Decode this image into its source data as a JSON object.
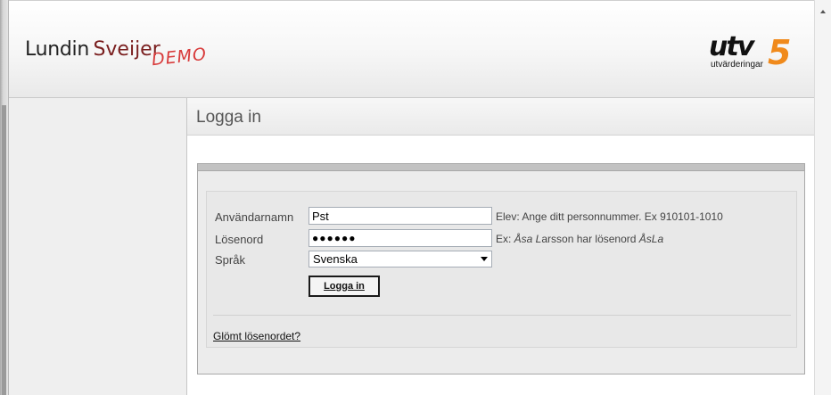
{
  "brand": {
    "name_part1": "Lundin",
    "name_part2": "Sveijer",
    "demo_label": "DEMO",
    "partner_logo_text": "utv",
    "partner_logo_number": "5",
    "partner_logo_sub": "utvärderingar"
  },
  "page": {
    "title": "Logga in"
  },
  "form": {
    "username_label": "Användarnamn",
    "username_value": "Pst",
    "username_hint": "Elev: Ange ditt personnummer. Ex 910101-1010",
    "password_label": "Lösenord",
    "password_masked": "●●●●●●",
    "password_hint_prefix": "Ex: ",
    "password_hint_name1": "Åsa L",
    "password_hint_name2": "arsson",
    "password_hint_mid": " har lösenord ",
    "password_hint_example": "ÅsLa",
    "language_label": "Språk",
    "language_value": "Svenska",
    "login_button": "Logga in",
    "forgot_link": "Glömt lösenordet?"
  }
}
